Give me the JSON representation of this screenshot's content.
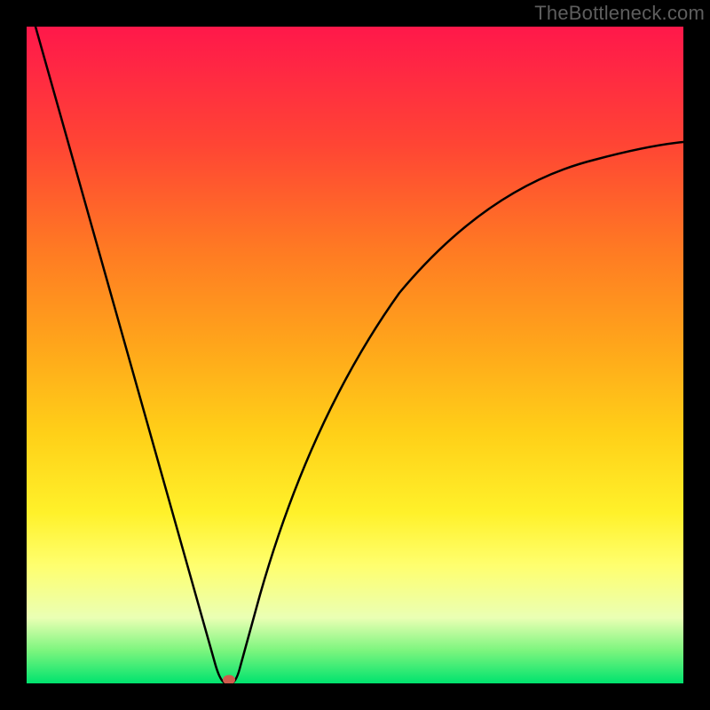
{
  "watermark": "TheBottleneck.com",
  "chart_data": {
    "type": "line",
    "title": "",
    "xlabel": "",
    "ylabel": "",
    "xlim": [
      0,
      100
    ],
    "ylim": [
      0,
      100
    ],
    "x": [
      0,
      5,
      10,
      15,
      20,
      25,
      27,
      29,
      30,
      31,
      33,
      35,
      40,
      45,
      50,
      55,
      60,
      65,
      70,
      75,
      80,
      85,
      90,
      95,
      100
    ],
    "y": [
      100,
      84,
      68,
      51,
      35,
      18,
      11,
      4,
      0,
      4,
      12,
      19,
      35,
      47,
      56,
      63,
      68,
      72,
      75,
      77,
      79,
      80,
      81,
      82,
      82
    ],
    "min_marker": {
      "x": 30,
      "y": 0
    },
    "note": "Values estimated from pixel positions on an unlabeled plot; y=0 is bottom, y=100 is top."
  }
}
